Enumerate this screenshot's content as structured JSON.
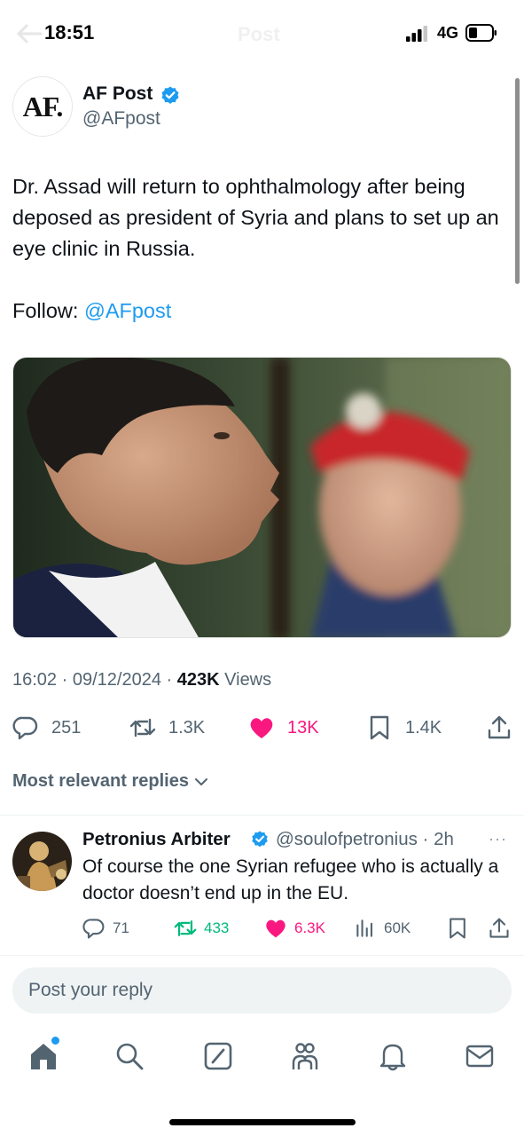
{
  "status_bar": {
    "time": "18:51",
    "network": "4G",
    "ghost_title": "Post"
  },
  "post": {
    "author_name": "AF Post",
    "author_handle": "@AFpost",
    "avatar_text": "AF.",
    "text": "Dr. Assad will return to ophthalmology after being deposed as president of Syria and plans to set up an eye clinic in Russia.",
    "follow_label": "Follow:",
    "follow_mention": "@AFpost",
    "time": "16:02",
    "date": "09/12/2024",
    "views_count": "423K",
    "views_label": "Views",
    "separator": "·",
    "replies": "251",
    "reposts": "1.3K",
    "likes": "13K",
    "bookmarks": "1.4K"
  },
  "replies_header": {
    "label": "Most relevant replies"
  },
  "reply": {
    "name": "Petronius Arbiter",
    "handle_time": "@soulofpetronius · 2h",
    "text": "Of course the one Syrian refugee who is actually a doctor doesn’t end up in the EU.",
    "replies": "71",
    "reposts": "433",
    "likes": "6.3K",
    "views": "60K",
    "more": "···"
  },
  "composer": {
    "placeholder": "Post your reply"
  },
  "colors": {
    "accent": "#1d9bf0",
    "like": "#f91880",
    "repost": "#00ba7c",
    "secondary_text": "#536471"
  },
  "icons": [
    "back-arrow-icon",
    "signal-icon",
    "battery-icon",
    "verified-icon",
    "reply-icon",
    "repost-icon",
    "heart-icon",
    "bookmark-icon",
    "share-icon",
    "chevron-down-icon",
    "views-icon",
    "home-icon",
    "search-icon",
    "compose-icon",
    "communities-icon",
    "bell-icon",
    "mail-icon"
  ]
}
